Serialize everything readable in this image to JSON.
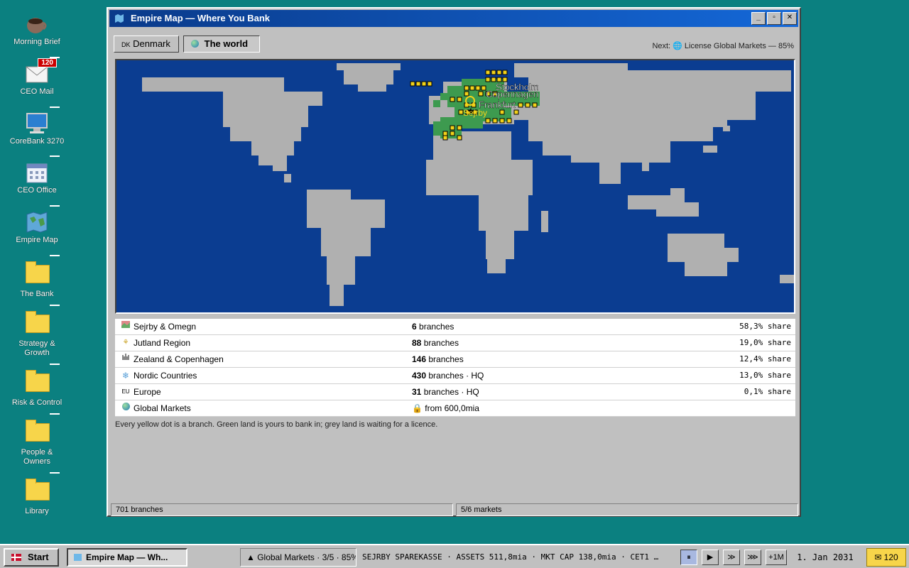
{
  "desktop": {
    "icons": [
      {
        "label": "Morning Brief",
        "icon": "coffee-cup-icon"
      },
      {
        "label": "CEO Mail",
        "icon": "mail-icon",
        "badge": "120"
      },
      {
        "label": "CoreBank 3270",
        "icon": "terminal-icon"
      },
      {
        "label": "CEO Office",
        "icon": "calendar-icon"
      },
      {
        "label": "Empire Map",
        "icon": "map-icon"
      },
      {
        "label": "The Bank",
        "icon": "folder-icon"
      },
      {
        "label": "Strategy & Growth",
        "icon": "folder-icon"
      },
      {
        "label": "Risk & Control",
        "icon": "folder-icon"
      },
      {
        "label": "People & Owners",
        "icon": "folder-icon"
      },
      {
        "label": "Library",
        "icon": "folder-icon"
      }
    ]
  },
  "window": {
    "title": "Empire Map — Where You Bank",
    "tabs": [
      {
        "prefix": "DK",
        "label": "Denmark",
        "active": false
      },
      {
        "label": "The world",
        "active": true,
        "icon": "globe-icon"
      }
    ],
    "next": "Next: 🌐 License Global Markets — 85%",
    "map": {
      "city_labels": [
        "Stockholm",
        "Copennagen",
        "Frankfurt",
        "Sejrby"
      ],
      "colors": {
        "ocean": "#0b3d91",
        "land": "#b0b0b0",
        "owned": "#3d9a4f",
        "branch": "#f2d21a"
      }
    },
    "regions": [
      {
        "icon": "region-map-icon",
        "name": "Sejrby & Omegn",
        "count": "6",
        "unit": " branches",
        "share": "58,3% share"
      },
      {
        "icon": "wheat-icon",
        "name": "Jutland Region",
        "count": "88",
        "unit": " branches",
        "share": "19,0% share"
      },
      {
        "icon": "castle-icon",
        "name": "Zealand & Copenhagen",
        "count": "146",
        "unit": " branches",
        "share": "12,4% share"
      },
      {
        "icon": "snowflake-icon",
        "name": "Nordic Countries",
        "count": "430",
        "unit": " branches · HQ",
        "share": "13,0% share"
      },
      {
        "icon": "eu-icon",
        "prefix": "EU",
        "name": "Europe",
        "count": "31",
        "unit": " branches · HQ",
        "share": "0,1% share"
      },
      {
        "icon": "globe-icon",
        "name": "Global Markets",
        "count": "",
        "unit": "🔒 from 600,0mia",
        "share": ""
      }
    ],
    "note": "Every yellow dot is a branch. Green land is yours to bank in; grey land is waiting for a licence.",
    "status": {
      "branches": "701 branches",
      "markets": "5/6 markets"
    }
  },
  "taskbar": {
    "start": "Start",
    "active_task": "Empire Map — Wh...",
    "goal": "▲ Global Markets · 3/5 · 85%",
    "ticker": "SEJRBY SPAREKASSE · ASSETS 511,8mia · MKT CAP 138,0mia · CET1 …",
    "controls": [
      "⏸",
      "▶",
      "≫",
      "⋙",
      "+1M"
    ],
    "date": "1. Jan 2031",
    "mail": "✉ 120"
  }
}
